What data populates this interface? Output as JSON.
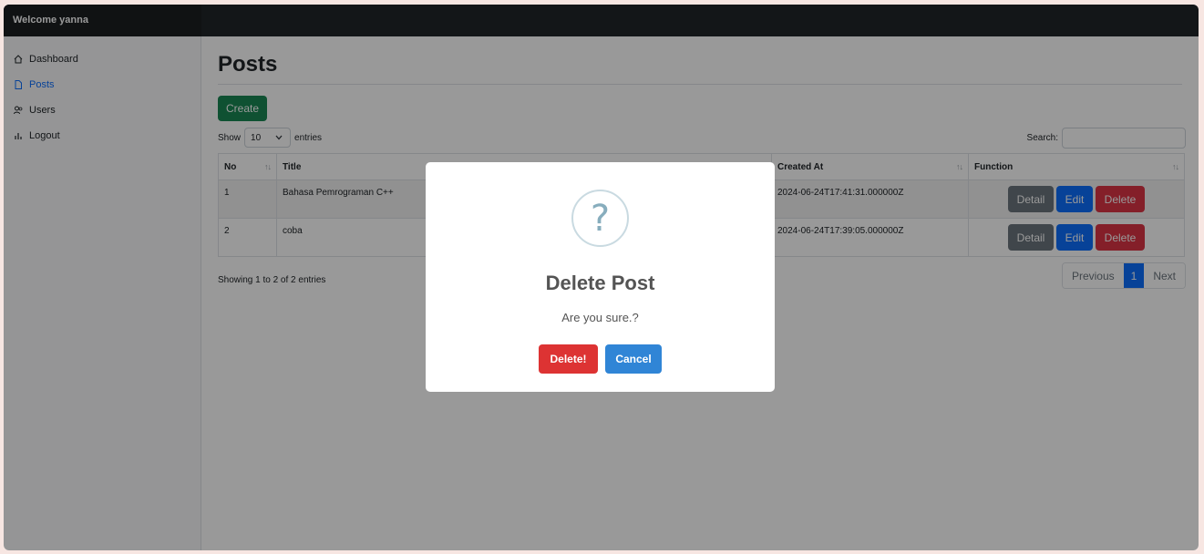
{
  "header": {
    "brand": "Welcome yanna"
  },
  "sidebar": {
    "items": [
      {
        "label": "Dashboard",
        "icon": "house-icon",
        "active": false
      },
      {
        "label": "Posts",
        "icon": "file-icon",
        "active": true
      },
      {
        "label": "Users",
        "icon": "people-icon",
        "active": false
      },
      {
        "label": "Logout",
        "icon": "bar-chart-icon",
        "active": false
      }
    ]
  },
  "main": {
    "title": "Posts",
    "create_label": "Create",
    "length": {
      "show": "Show",
      "value": "10",
      "entries": "entries"
    },
    "search": {
      "label": "Search:",
      "value": ""
    },
    "table": {
      "columns": [
        "No",
        "Title",
        "Created At",
        "Function"
      ],
      "rows": [
        {
          "no": "1",
          "title": "Bahasa Pemrograman C++",
          "created_at": "2024-06-24T17:41:31.000000Z"
        },
        {
          "no": "2",
          "title": "coba",
          "created_at": "2024-06-24T17:39:05.000000Z"
        }
      ],
      "actions": {
        "detail": "Detail",
        "edit": "Edit",
        "delete": "Delete"
      },
      "sort_glyph": "↑↓"
    },
    "info": "Showing 1 to 2 of 2 entries",
    "pagination": {
      "previous": "Previous",
      "current": "1",
      "next": "Next"
    }
  },
  "modal": {
    "icon": "?",
    "title": "Delete Post",
    "text": "Are you sure.?",
    "confirm": "Delete!",
    "cancel": "Cancel"
  },
  "colors": {
    "topbar": "#212529",
    "primary": "#0d6efd",
    "success": "#198754",
    "danger": "#dc3545",
    "secondary": "#6c757d",
    "modal_confirm": "#dd3333",
    "modal_cancel": "#3085d6"
  }
}
